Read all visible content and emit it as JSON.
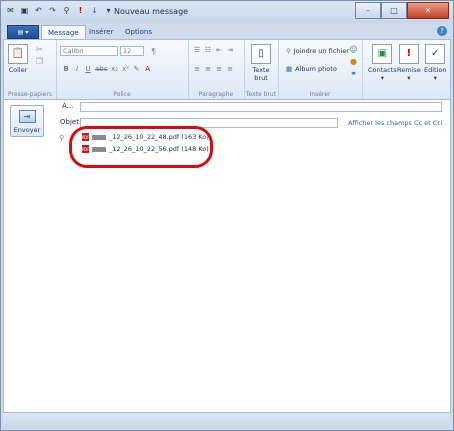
{
  "window": {
    "title": "Nouveau message"
  },
  "tabs": [
    {
      "label": "Message"
    },
    {
      "label": "Insérer"
    },
    {
      "label": "Options"
    }
  ],
  "ribbon": {
    "paste": {
      "label": "Coller",
      "group": "Presse-papiers"
    },
    "font": {
      "name": "Calibri",
      "size": "12",
      "group": "Police"
    },
    "paragraph": {
      "group": "Paragraphe"
    },
    "plain_text": {
      "label1": "Texte",
      "label2": "brut",
      "group": "Texte brut"
    },
    "insert": {
      "attach": "Joindre un fichier",
      "album": "Album photo",
      "group": "Insérer"
    },
    "contacts": "Contacts",
    "remise": "Remise",
    "edition": "Edition"
  },
  "compose": {
    "send_label": "Envoyer",
    "to_label": "À...",
    "subject_label": "Objet",
    "show_cc": "Afficher les champs Cc et Cci",
    "attachments": [
      {
        "name": "_12_26_10_22_48.pdf (163 Ko)"
      },
      {
        "name": "_12_26_10_22_56.pdf (148 Ko)"
      }
    ]
  }
}
